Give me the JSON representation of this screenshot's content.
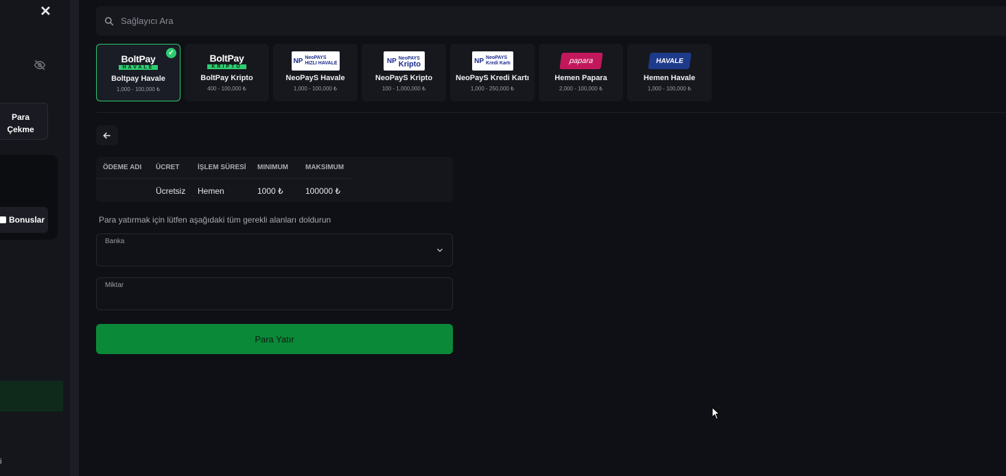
{
  "sidebar": {
    "close_symbol": "✕",
    "withdraw_label_line1": "Para",
    "withdraw_label_line2": "Çekme",
    "bonuses_label": "Bonuslar",
    "fragment_char": "i"
  },
  "search": {
    "placeholder": "Sağlayıcı Ara"
  },
  "providers": [
    {
      "logo_text": "BoltPay",
      "logo_sub": "HAVALE",
      "name": "Boltpay Havale",
      "range": "1,000 - 100,000 ₺",
      "selected": true
    },
    {
      "logo_text": "BoltPay",
      "logo_sub": "KRIPTO",
      "name": "BoltPay Kripto",
      "range": "400 - 100,000 ₺",
      "selected": false
    },
    {
      "logo_text": "NeoPAYS",
      "logo_sub": "HIZLI HAVALE",
      "name": "NeoPayS Havale",
      "range": "1,000 - 100,000 ₺",
      "selected": false
    },
    {
      "logo_text": "NeoPAYS",
      "logo_sub": "Kripto",
      "name": "NeoPayS Kripto",
      "range": "100 - 1,000,000 ₺",
      "selected": false
    },
    {
      "logo_text": "NeoPAYS",
      "logo_sub": "Kredi Kartı",
      "name": "NeoPayS Kredi Kartı",
      "range": "1,000 - 250,000 ₺",
      "selected": false
    },
    {
      "logo_text": "papara",
      "logo_sub": "",
      "name": "Hemen Papara",
      "range": "2,000 - 100,000 ₺",
      "selected": false
    },
    {
      "logo_text": "HAVALE",
      "logo_sub": "",
      "name": "Hemen Havale",
      "range": "1,000 - 100,000 ₺",
      "selected": false
    }
  ],
  "table": {
    "headers": [
      "ÖDEME ADI",
      "ÜCRET",
      "İŞLEM SÜRESİ",
      "MINIMUM",
      "MAKSIMUM"
    ],
    "row": {
      "name": "",
      "fee": "Ücretsiz",
      "duration": "Hemen",
      "min": "1000 ₺",
      "max": "100000 ₺"
    }
  },
  "form": {
    "instruction": "Para yatırmak için lütfen aşağıdaki tüm gerekli alanları doldurun",
    "bank_label": "Banka",
    "bank_value": "",
    "amount_label": "Miktar",
    "amount_value": "",
    "submit_label": "Para Yatır"
  },
  "colors": {
    "accent": "#2ecc71",
    "submit": "#0a8a38",
    "bg": "#0f1015"
  }
}
